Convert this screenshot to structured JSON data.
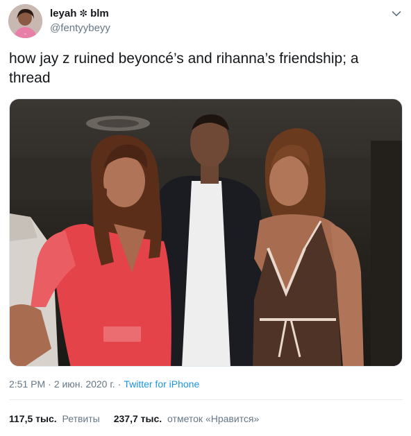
{
  "user": {
    "display_name": "leyah",
    "flower_symbol": "✼",
    "name_suffix": "blm",
    "handle": "@fentyybeyy"
  },
  "tweet": {
    "text": "how jay z ruined beyoncé’s and rihanna’s friendship; a thread",
    "time": "2:51 PM",
    "date": "2 июн. 2020 г.",
    "separator": "·",
    "source": "Twitter for iPhone"
  },
  "stats": {
    "retweets_count": "117,5 тыс.",
    "retweets_label": "Ретвиты",
    "likes_count": "237,7 тыс.",
    "likes_label": "отметок «Нравится»"
  },
  "colors": {
    "text": "#14171a",
    "secondary": "#657786",
    "link": "#1b95e0",
    "divider": "#e6ecf0"
  },
  "icons": {
    "caret": "chevron-down-icon"
  }
}
